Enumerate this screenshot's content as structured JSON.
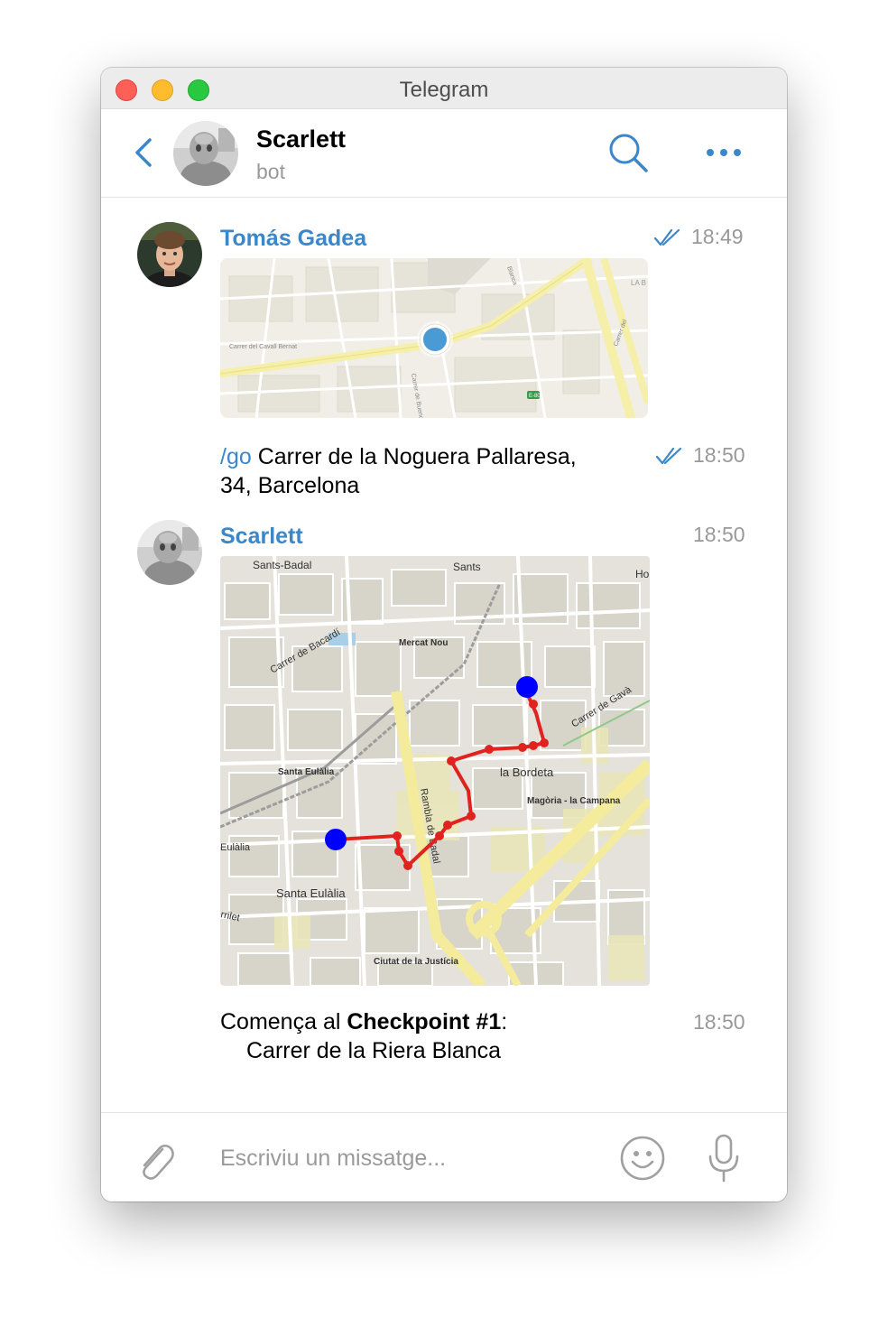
{
  "window": {
    "title": "Telegram"
  },
  "chat": {
    "name": "Scarlett",
    "status": "bot"
  },
  "messages": [
    {
      "sender": "Tomás Gadea",
      "time": "18:49",
      "kind": "location",
      "read": true
    },
    {
      "command": "/go",
      "text_line1": " Carrer de la Noguera Pallaresa,",
      "text_line2": "34, Barcelona",
      "time": "18:50",
      "read": true
    },
    {
      "sender": "Scarlett",
      "time": "18:50",
      "kind": "route-map",
      "map_labels": [
        "Sants-Badal",
        "Sants",
        "Ho",
        "Carrer de Bacardí",
        "Mercat Nou",
        "Carrer de Gavà",
        "Santa Eulàlia",
        "la Bordeta",
        "Magòria - la Campana",
        "Eulàlia",
        "Rambla de Badal",
        "Santa Eulàlia",
        "rrilet",
        "Ciutat de la Justícia"
      ]
    },
    {
      "text_prefix": "Comença al ",
      "text_bold": "Checkpoint #1",
      "text_suffix": ":",
      "text_line2": "Carrer de la Riera Blanca",
      "time": "18:50"
    }
  ],
  "location_map_labels": [
    "Carrer del Cavall Bernat",
    "Carrer de Buenos Aires",
    "Blanca",
    "Carrer del",
    "LA B",
    "E-80"
  ],
  "composer": {
    "placeholder": "Escriviu un missatge..."
  },
  "colors": {
    "accent": "#3b87c9",
    "route": "#e1231f",
    "checkpoint": "#0000ff",
    "location_dot": "#4a9ad4"
  },
  "icons": [
    "chevron-left-icon",
    "search-icon",
    "more-dots-icon",
    "double-check-icon",
    "paperclip-icon",
    "emoji-icon",
    "microphone-icon"
  ]
}
